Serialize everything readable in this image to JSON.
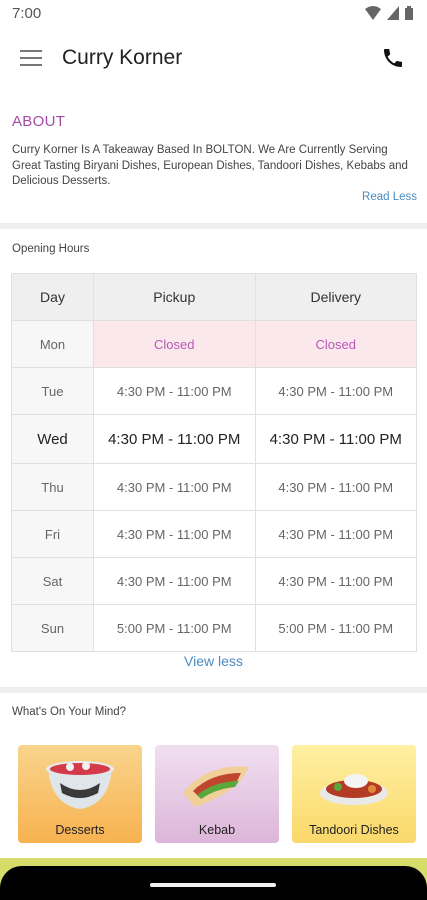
{
  "status_bar": {
    "time": "7:00"
  },
  "app_bar": {
    "title": "Curry Korner",
    "menu_icon": "hamburger-menu-icon",
    "phone_icon": "phone-icon"
  },
  "about": {
    "heading": "ABOUT",
    "text": "Curry Korner Is A Takeaway Based In BOLTON. We Are Currently Serving Great Tasting Biryani Dishes, European Dishes, Tandoori Dishes, Kebabs and Delicious Desserts.",
    "read_less": "Read Less"
  },
  "opening_hours": {
    "title": "Opening Hours",
    "headers": [
      "Day",
      "Pickup",
      "Delivery"
    ],
    "rows": [
      {
        "day": "Mon",
        "pickup": "Closed",
        "delivery": "Closed"
      },
      {
        "day": "Tue",
        "pickup": "4:30 PM - 11:00 PM",
        "delivery": "4:30 PM - 11:00 PM"
      },
      {
        "day": "Wed",
        "pickup": "4:30 PM - 11:00 PM",
        "delivery": "4:30 PM - 11:00 PM"
      },
      {
        "day": "Thu",
        "pickup": "4:30 PM - 11:00 PM",
        "delivery": "4:30 PM - 11:00 PM"
      },
      {
        "day": "Fri",
        "pickup": "4:30 PM - 11:00 PM",
        "delivery": "4:30 PM - 11:00 PM"
      },
      {
        "day": "Sat",
        "pickup": "4:30 PM - 11:00 PM",
        "delivery": "4:30 PM - 11:00 PM"
      },
      {
        "day": "Sun",
        "pickup": "5:00 PM - 11:00 PM",
        "delivery": "5:00 PM - 11:00 PM"
      }
    ],
    "view_less": "View less"
  },
  "mind": {
    "title": "What's On Your Mind?",
    "cards": [
      {
        "label": "Desserts",
        "icon": "dessert-bowl-icon"
      },
      {
        "label": "Kebab",
        "icon": "kebab-wrap-icon"
      },
      {
        "label": "Tandoori Dishes",
        "icon": "tandoori-plate-icon"
      }
    ]
  },
  "colors": {
    "accent": "#a64ca6",
    "link": "#4a8bc0",
    "closed_bg": "#fbe8ec"
  }
}
